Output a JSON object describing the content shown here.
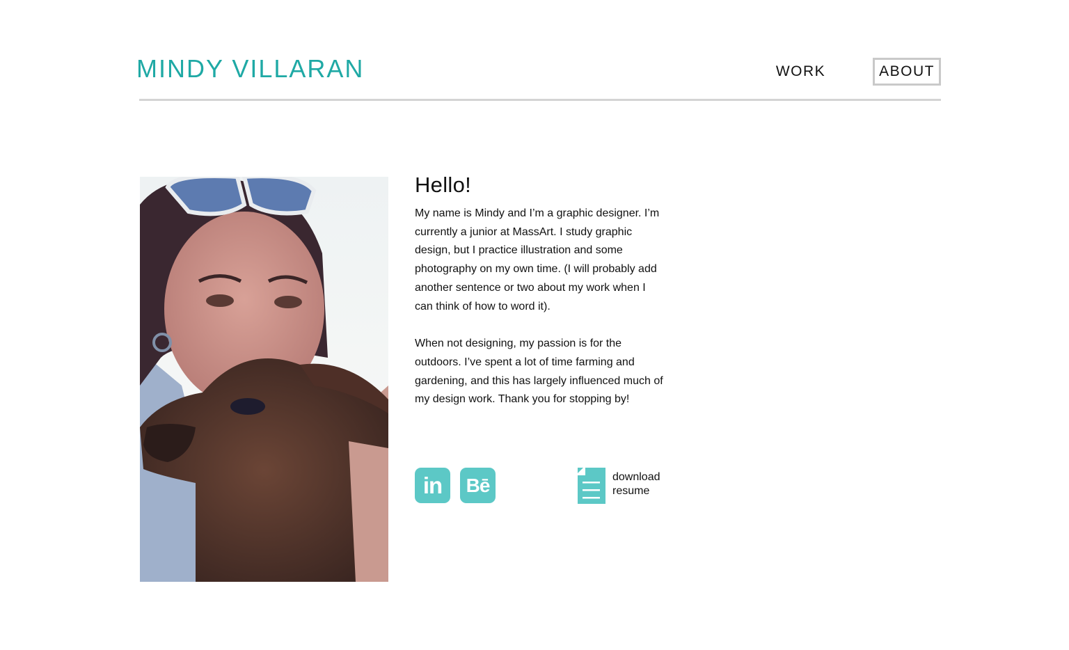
{
  "site": {
    "title": "MINDY VILLARAN"
  },
  "nav": {
    "work": "WORK",
    "about": "ABOUT"
  },
  "about": {
    "heading": "Hello!",
    "paragraph1": "My name is Mindy and I’m a graphic designer. I’m currently a junior at MassArt. I study graphic design, but I practice illustration and some photography on my own time. (I will probably add another sentence or two about my work when I can think of how to word it).",
    "paragraph2": "When not designing, my passion is for the outdoors. I’ve spent a lot of time farming and gardening, and this has largely influenced much of my design work. Thank you for stopping by!"
  },
  "links": {
    "linkedin": "in",
    "behance": "Bē",
    "resume": "download resume"
  },
  "colors": {
    "accent": "#1fa9a5",
    "icon": "#5cc8c6",
    "rule": "#d4d4d4"
  },
  "icons": [
    "linkedin-icon",
    "behance-icon",
    "document-icon"
  ]
}
